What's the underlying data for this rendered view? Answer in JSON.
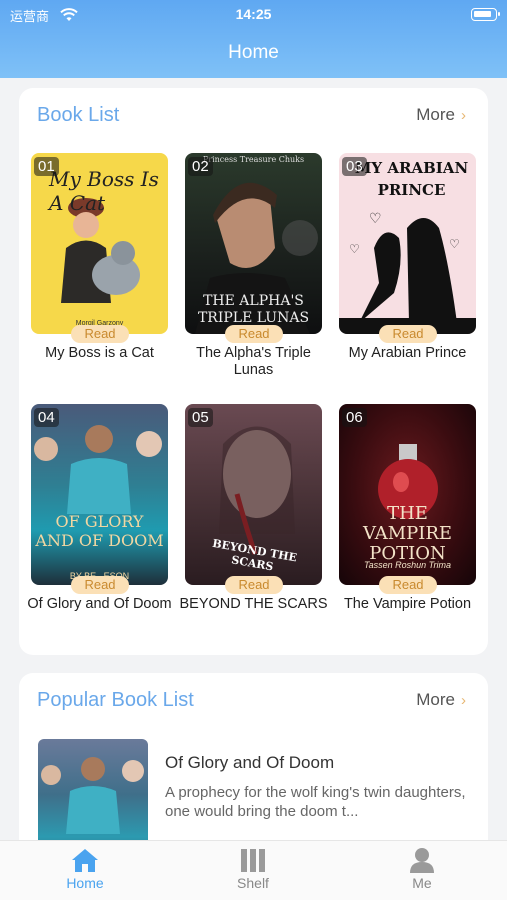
{
  "status_bar": {
    "carrier": "运营商",
    "time": "14:25"
  },
  "header": {
    "title": "Home"
  },
  "book_list": {
    "title": "Book List",
    "more": "More",
    "read_label": "Read",
    "books": [
      {
        "num": "01",
        "title": "My Boss is a Cat",
        "cover_text": "My Boss Is A Cat",
        "cover_sub": "Morgil Garzony"
      },
      {
        "num": "02",
        "title": "The Alpha's Triple Lunas",
        "cover_text": "THE ALPHA'S TRIPLE LUNAS",
        "cover_sub": "Princess Treasure Chuks"
      },
      {
        "num": "03",
        "title": "My Arabian Prince",
        "cover_text": "MY ARABIAN PRINCE"
      },
      {
        "num": "04",
        "title": "Of Glory and Of Doom",
        "cover_text": "OF GLORY AND OF DOOM",
        "cover_sub": "BY BE...ESON"
      },
      {
        "num": "05",
        "title": "BEYOND THE SCARS",
        "cover_text": "BEYOND THE SCARS"
      },
      {
        "num": "06",
        "title": "The Vampire Potion",
        "cover_text": "THE VAMPIRE POTION",
        "cover_sub": "Tassen Roshun Trima"
      }
    ]
  },
  "popular": {
    "title": "Popular Book List",
    "more": "More",
    "item": {
      "title": "Of Glory and Of Doom",
      "description": "A prophecy for the wolf king's twin daughters, one would bring the doom t..."
    }
  },
  "tabs": [
    {
      "label": "Home",
      "icon": "home-icon",
      "active": true
    },
    {
      "label": "Shelf",
      "icon": "shelf-icon",
      "active": false
    },
    {
      "label": "Me",
      "icon": "person-icon",
      "active": false
    }
  ],
  "colors": {
    "accent": "#4aa3ef",
    "section_title": "#6aa8ea",
    "read_badge": "#fbe0b6",
    "header_top": "#5fa8f2"
  }
}
